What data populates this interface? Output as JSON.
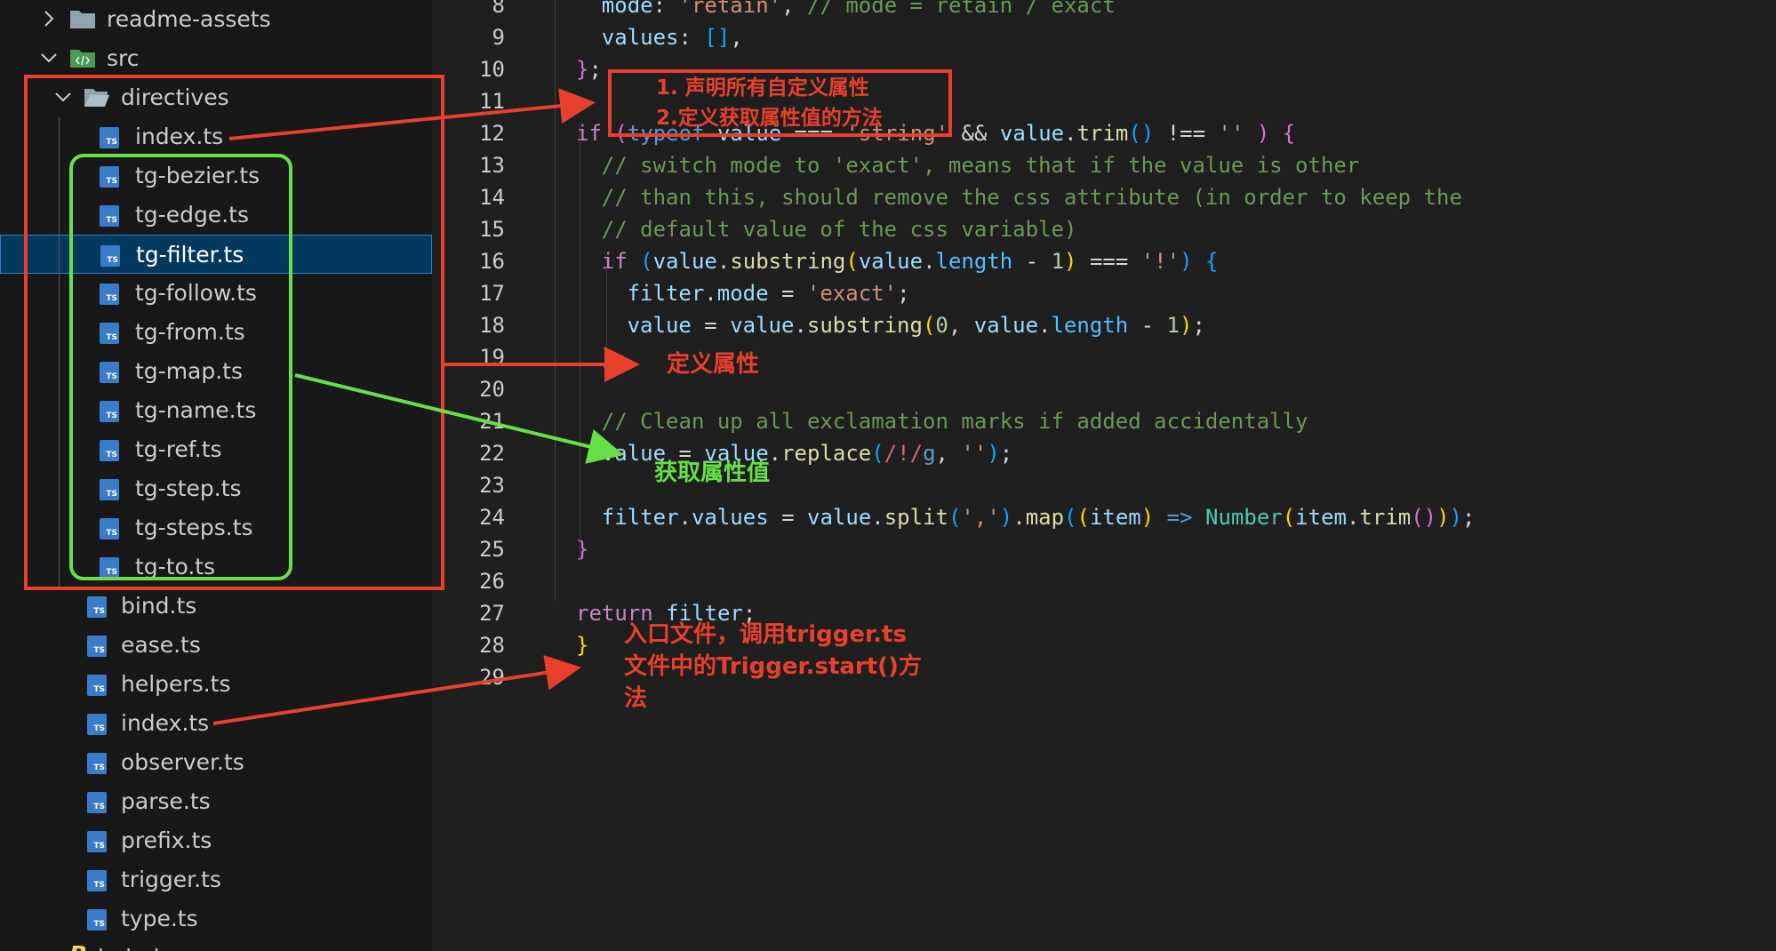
{
  "explorer": {
    "items": [
      {
        "label": "readme-assets",
        "type": "folder",
        "state": "collapsed"
      },
      {
        "label": "src",
        "type": "src-folder",
        "state": "expanded"
      },
      {
        "label": "directives",
        "type": "folder",
        "state": "expanded"
      },
      {
        "label": "index.ts",
        "type": "ts"
      },
      {
        "label": "tg-bezier.ts",
        "type": "ts"
      },
      {
        "label": "tg-edge.ts",
        "type": "ts"
      },
      {
        "label": "tg-filter.ts",
        "type": "ts",
        "selected": true
      },
      {
        "label": "tg-follow.ts",
        "type": "ts"
      },
      {
        "label": "tg-from.ts",
        "type": "ts"
      },
      {
        "label": "tg-map.ts",
        "type": "ts"
      },
      {
        "label": "tg-name.ts",
        "type": "ts"
      },
      {
        "label": "tg-ref.ts",
        "type": "ts"
      },
      {
        "label": "tg-step.ts",
        "type": "ts"
      },
      {
        "label": "tg-steps.ts",
        "type": "ts"
      },
      {
        "label": "tg-to.ts",
        "type": "ts"
      },
      {
        "label": "bind.ts",
        "type": "ts"
      },
      {
        "label": "ease.ts",
        "type": "ts"
      },
      {
        "label": "helpers.ts",
        "type": "ts"
      },
      {
        "label": "index.ts",
        "type": "ts"
      },
      {
        "label": "observer.ts",
        "type": "ts"
      },
      {
        "label": "parse.ts",
        "type": "ts"
      },
      {
        "label": "prefix.ts",
        "type": "ts"
      },
      {
        "label": "trigger.ts",
        "type": "ts"
      },
      {
        "label": "type.ts",
        "type": "ts"
      },
      {
        "label": "babel",
        "type": "babel"
      }
    ],
    "ts_badge": "TS"
  },
  "editor": {
    "lines": [
      {
        "n": "8",
        "tokens": [
          [
            "c-var",
            "mode"
          ],
          [
            "c-op",
            ": "
          ],
          [
            "c-str",
            "'retain'"
          ],
          [
            "c-op",
            ", "
          ],
          [
            "c-com",
            "// mode = retain / exact"
          ]
        ]
      },
      {
        "n": "9",
        "tokens": [
          [
            "c-var",
            "values"
          ],
          [
            "c-op",
            ": "
          ],
          [
            "c-b3",
            "[]"
          ],
          [
            "c-op",
            ","
          ]
        ]
      },
      {
        "n": "10",
        "tokens": [
          [
            "c-b2",
            "}"
          ],
          [
            "c-op",
            ";"
          ]
        ]
      },
      {
        "n": "11",
        "tokens": []
      },
      {
        "n": "12",
        "tokens": [
          [
            "c-kw",
            "if "
          ],
          [
            "c-b2",
            "("
          ],
          [
            "c-arrow",
            "typeof "
          ],
          [
            "c-var",
            "value "
          ],
          [
            "c-op",
            "=== "
          ],
          [
            "c-str",
            "'string' "
          ],
          [
            "c-op",
            "&& "
          ],
          [
            "c-var",
            "value"
          ],
          [
            "c-op",
            "."
          ],
          [
            "c-fn",
            "trim"
          ],
          [
            "c-b3",
            "() "
          ],
          [
            "c-op",
            "!== "
          ],
          [
            "c-str",
            "'' "
          ],
          [
            "c-b2",
            ") {"
          ]
        ]
      },
      {
        "n": "13",
        "tokens": [
          [
            "c-com",
            "// switch mode to 'exact', means that if the value is other"
          ]
        ]
      },
      {
        "n": "14",
        "tokens": [
          [
            "c-com",
            "// than this, should remove the css attribute (in order to keep the"
          ]
        ]
      },
      {
        "n": "15",
        "tokens": [
          [
            "c-com",
            "// default value of the css variable)"
          ]
        ]
      },
      {
        "n": "16",
        "tokens": [
          [
            "c-kw",
            "if "
          ],
          [
            "c-b3",
            "("
          ],
          [
            "c-var",
            "value"
          ],
          [
            "c-op",
            "."
          ],
          [
            "c-fn",
            "substring"
          ],
          [
            "c-b1",
            "("
          ],
          [
            "c-var",
            "value"
          ],
          [
            "c-op",
            "."
          ],
          [
            "c-prop",
            "length "
          ],
          [
            "c-op",
            "- "
          ],
          [
            "c-num",
            "1"
          ],
          [
            "c-b1",
            ") "
          ],
          [
            "c-op",
            "=== "
          ],
          [
            "c-str",
            "'!'"
          ],
          [
            "c-b3",
            ") {"
          ]
        ]
      },
      {
        "n": "17",
        "tokens": [
          [
            "c-var",
            "filter"
          ],
          [
            "c-op",
            "."
          ],
          [
            "c-var",
            "mode "
          ],
          [
            "c-op",
            "= "
          ],
          [
            "c-str",
            "'exact'"
          ],
          [
            "c-op",
            ";"
          ]
        ]
      },
      {
        "n": "18",
        "tokens": [
          [
            "c-var",
            "value "
          ],
          [
            "c-op",
            "= "
          ],
          [
            "c-var",
            "value"
          ],
          [
            "c-op",
            "."
          ],
          [
            "c-fn",
            "substring"
          ],
          [
            "c-b1",
            "("
          ],
          [
            "c-num",
            "0"
          ],
          [
            "c-op",
            ", "
          ],
          [
            "c-var",
            "value"
          ],
          [
            "c-op",
            "."
          ],
          [
            "c-prop",
            "length "
          ],
          [
            "c-op",
            "- "
          ],
          [
            "c-num",
            "1"
          ],
          [
            "c-b1",
            ")"
          ],
          [
            "c-op",
            ";"
          ]
        ]
      },
      {
        "n": "19",
        "tokens": [
          [
            "c-b3",
            "}"
          ]
        ]
      },
      {
        "n": "20",
        "tokens": []
      },
      {
        "n": "21",
        "tokens": [
          [
            "c-com",
            "// Clean up all exclamation marks if added accidentally"
          ]
        ]
      },
      {
        "n": "22",
        "tokens": [
          [
            "c-var",
            "value "
          ],
          [
            "c-op",
            "= "
          ],
          [
            "c-var",
            "value"
          ],
          [
            "c-op",
            "."
          ],
          [
            "c-fn",
            "replace"
          ],
          [
            "c-b3",
            "("
          ],
          [
            "c-rx",
            "/!/"
          ],
          [
            "c-arrow",
            "g"
          ],
          [
            "c-op",
            ", "
          ],
          [
            "c-str",
            "''"
          ],
          [
            "c-b3",
            ")"
          ],
          [
            "c-op",
            ";"
          ]
        ]
      },
      {
        "n": "23",
        "tokens": []
      },
      {
        "n": "24",
        "tokens": [
          [
            "c-var",
            "filter"
          ],
          [
            "c-op",
            "."
          ],
          [
            "c-var",
            "values "
          ],
          [
            "c-op",
            "= "
          ],
          [
            "c-var",
            "value"
          ],
          [
            "c-op",
            "."
          ],
          [
            "c-fn",
            "split"
          ],
          [
            "c-b3",
            "("
          ],
          [
            "c-str",
            "','"
          ],
          [
            "c-b3",
            ")"
          ],
          [
            "c-op",
            "."
          ],
          [
            "c-fn",
            "map"
          ],
          [
            "c-b3",
            "("
          ],
          [
            "c-b1",
            "("
          ],
          [
            "c-var",
            "item"
          ],
          [
            "c-b1",
            ") "
          ],
          [
            "c-arrow",
            "=> "
          ],
          [
            "c-cls",
            "Number"
          ],
          [
            "c-b1",
            "("
          ],
          [
            "c-var",
            "item"
          ],
          [
            "c-op",
            "."
          ],
          [
            "c-fn",
            "trim"
          ],
          [
            "c-b2",
            "()"
          ],
          [
            "c-b1",
            ")"
          ],
          [
            "c-b3",
            ")"
          ],
          [
            "c-op",
            ";"
          ]
        ]
      },
      {
        "n": "25",
        "tokens": [
          [
            "c-b2",
            "}"
          ]
        ]
      },
      {
        "n": "26",
        "tokens": []
      },
      {
        "n": "27",
        "tokens": [
          [
            "c-kw",
            "return "
          ],
          [
            "c-var",
            "filter"
          ],
          [
            "c-op",
            ";"
          ]
        ]
      },
      {
        "n": "28",
        "tokens": [
          [
            "c-b1",
            "}"
          ]
        ]
      },
      {
        "n": "29",
        "tokens": []
      }
    ]
  },
  "annotations": {
    "note_declare": "1. 声明所有自定义属性\n2.定义获取属性值的方法",
    "note_define": "定义属性",
    "note_get": "获取属性值",
    "note_entry": "入口文件，调用trigger.ts\n文件中的Trigger.start()方\n法"
  },
  "colors": {
    "annotation_red": "#e8402c",
    "annotation_green": "#66e046",
    "selection": "#04395e"
  }
}
